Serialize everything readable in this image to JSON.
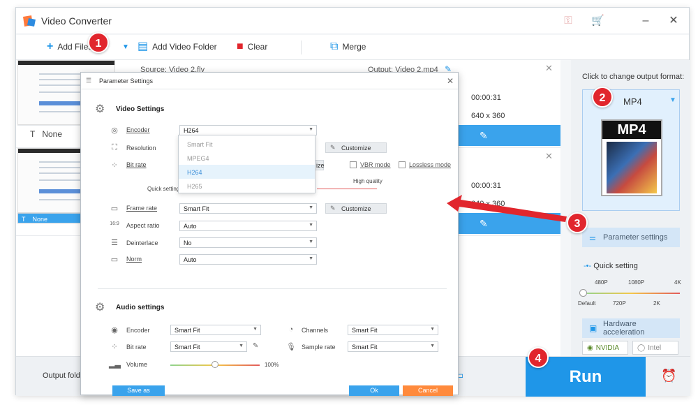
{
  "app": {
    "title": "Video Converter"
  },
  "toolbar": {
    "add_files": "Add Files",
    "add_folder": "Add Video Folder",
    "clear": "Clear",
    "merge": "Merge"
  },
  "videos": [
    {
      "source": "Source: Video 2.flv",
      "output": "Output: Video 2.mp4",
      "duration": "00:00:31",
      "resolution": "640 x 360",
      "subtitle": "None"
    },
    {
      "source": "",
      "output": "",
      "duration": "00:00:31",
      "resolution": "640 x 360",
      "subtitle": "None"
    }
  ],
  "right_panel": {
    "title": "Click to change output format:",
    "format": "MP4",
    "format_box_label": "MP4",
    "parameter_settings": "Parameter settings",
    "quick_setting": "Quick setting",
    "ticks_top": [
      "480P",
      "1080P",
      "4K"
    ],
    "ticks_bottom": [
      "Default",
      "720P",
      "2K"
    ],
    "hw_accel": "Hardware acceleration",
    "nvidia": "NVIDIA",
    "intel": "Intel"
  },
  "bottom": {
    "output_folder": "Output folde",
    "run": "Run"
  },
  "dialog": {
    "title": "Parameter Settings",
    "video_header": "Video Settings",
    "encoder_label": "Encoder",
    "encoder_value": "H264",
    "resolution_label": "Resolution",
    "bitrate_label": "Bit rate",
    "quick_setting": "Quick setting",
    "high_quality": "High quality",
    "customize": "Customize",
    "customize_bitrate_tail": "ize",
    "vbr_mode": "VBR mode",
    "lossless_mode": "Lossless mode",
    "framerate_label": "Frame rate",
    "framerate_value": "Smart Fit",
    "aspect_label": "Aspect ratio",
    "aspect_value": "Auto",
    "deinterlace_label": "Deinterlace",
    "deinterlace_value": "No",
    "norm_label": "Norm",
    "norm_value": "Auto",
    "audio_header": "Audio settings",
    "a_encoder_label": "Encoder",
    "a_encoder_value": "Smart Fit",
    "a_bitrate_label": "Bit rate",
    "a_bitrate_value": "Smart Fit",
    "a_volume_label": "Volume",
    "a_volume_value": "100%",
    "a_channels_label": "Channels",
    "a_channels_value": "Smart Fit",
    "a_sample_label": "Sample rate",
    "a_sample_value": "Smart Fit",
    "save_as": "Save as",
    "ok": "Ok",
    "cancel": "Cancel",
    "encoder_options": [
      "Smart Fit",
      "MPEG4",
      "H264",
      "H265"
    ],
    "encoder_selected": "H264"
  },
  "annotations": [
    "1",
    "2",
    "3",
    "4"
  ],
  "colors": {
    "accent": "#1f96e8",
    "badge": "#e1262d",
    "arrow": "#e1262d"
  }
}
